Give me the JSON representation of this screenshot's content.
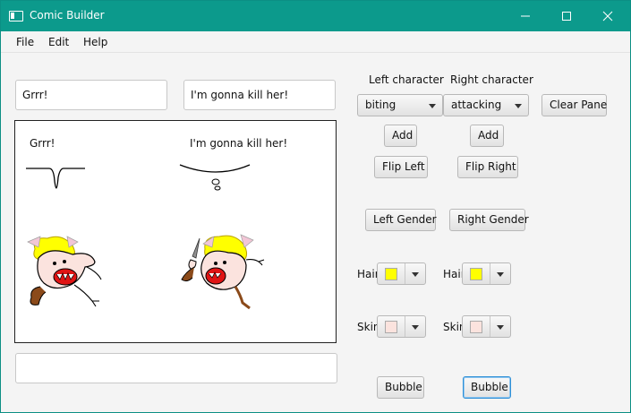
{
  "window": {
    "title": "Comic Builder",
    "icons": {
      "app": "app-window-icon",
      "minimize": "minimize-icon",
      "maximize": "maximize-icon",
      "close": "close-icon"
    }
  },
  "menu": {
    "file": "File",
    "edit": "Edit",
    "help": "Help"
  },
  "left_text_value": "Grrr!",
  "right_text_value": "I'm gonna kill her!",
  "bottom_text_value": "",
  "canvas": {
    "left_speech": "Grrr!",
    "right_speech": "I'm gonna kill her!",
    "hair_color": "#ffff00",
    "skin_color": "#fbe3de"
  },
  "controls": {
    "left_heading": "Left character",
    "right_heading": "Right character",
    "left_pose": "biting",
    "right_pose": "attacking",
    "clear_pane": "Clear Pane",
    "add": "Add",
    "flip_left": "Flip Left",
    "flip_right": "Flip Right",
    "left_gender": "Left Gender",
    "right_gender": "Right Gender",
    "hair_label": "Hair",
    "skin_label": "Skin",
    "bubble": "Bubble",
    "left_hair_color": "#ffff00",
    "right_hair_color": "#ffff00",
    "left_skin_color": "#fbe3de",
    "right_skin_color": "#fbe3de"
  }
}
